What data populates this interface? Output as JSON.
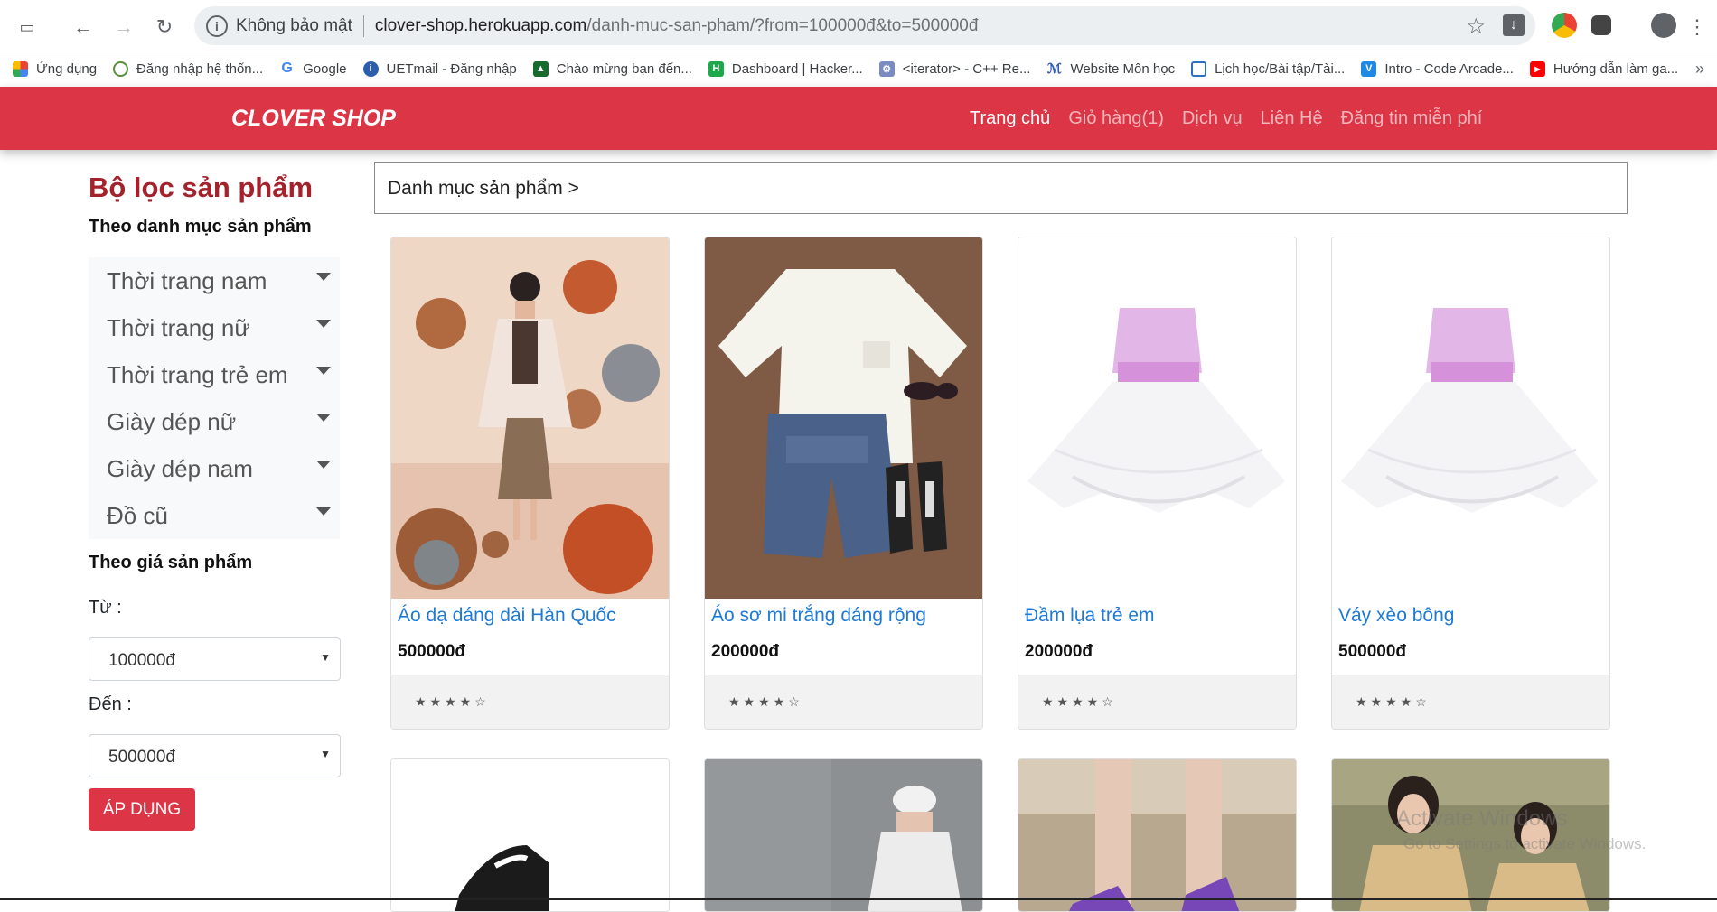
{
  "browser": {
    "security_label": "Không bảo mật",
    "url_host": "clover-shop.herokuapp.com",
    "url_path": "/danh-muc-san-pham/?from=100000đ&to=500000đ",
    "bookmarks": [
      {
        "label": "Ứng dụng",
        "icon": "apps-grid-icon"
      },
      {
        "label": "Đăng nhập hệ thốn...",
        "icon": "globe-icon"
      },
      {
        "label": "Google",
        "icon": "google-icon"
      },
      {
        "label": "UETmail - Đăng nhập",
        "icon": "info-icon"
      },
      {
        "label": "Chào mừng bạn đến...",
        "icon": "course-icon"
      },
      {
        "label": "Dashboard | Hacker...",
        "icon": "hackerrank-icon"
      },
      {
        "label": "<iterator> - C++ Re...",
        "icon": "cpp-icon"
      },
      {
        "label": "Website Môn học",
        "icon": "moodle-icon"
      },
      {
        "label": "Lịch học/Bài tập/Tài...",
        "icon": "calendar-icon"
      },
      {
        "label": "Intro - Code Arcade...",
        "icon": "codesignal-icon"
      },
      {
        "label": "Hướng dẫn làm ga...",
        "icon": "youtube-icon"
      }
    ],
    "more": "»"
  },
  "nav": {
    "brand": "CLOVER SHOP",
    "items": [
      "Trang chủ",
      "Giỏ hàng(1)",
      "Dịch vụ",
      "Liên Hệ",
      "Đăng tin miễn phí"
    ]
  },
  "sidebar": {
    "title": "Bộ lọc sản phẩm",
    "category_heading": "Theo danh mục sản phẩm",
    "categories": [
      "Thời trang nam",
      "Thời trang nữ",
      "Thời trang trẻ em",
      "Giày dép nữ",
      "Giày dép nam",
      "Đồ cũ"
    ],
    "price_heading": "Theo giá sản phẩm",
    "from_label": "Từ :",
    "from_value": "100000đ",
    "to_label": "Đến :",
    "to_value": "500000đ",
    "apply": "ÁP DỤNG"
  },
  "breadcrumb": "Danh mục sản phẩm >",
  "products": [
    {
      "name": "Áo dạ dáng dài Hàn Quốc",
      "price": "500000đ",
      "stars": "★★★★☆",
      "rating": 4
    },
    {
      "name": "Áo sơ mi trắng dáng rộng",
      "price": "200000đ",
      "stars": "★★★★☆",
      "rating": 4
    },
    {
      "name": "Đầm lụa trẻ em",
      "price": "200000đ",
      "stars": "★★★★☆",
      "rating": 4
    },
    {
      "name": "Váy xèo bông",
      "price": "500000đ",
      "stars": "★★★★☆",
      "rating": 4
    }
  ],
  "watermark": {
    "line1": "Activate Windows",
    "line2": "Go to Settings to activate Windows."
  },
  "colors": {
    "brand_red": "#dc3545",
    "title_red": "#a3222c",
    "link_blue": "#1e7ad6"
  }
}
